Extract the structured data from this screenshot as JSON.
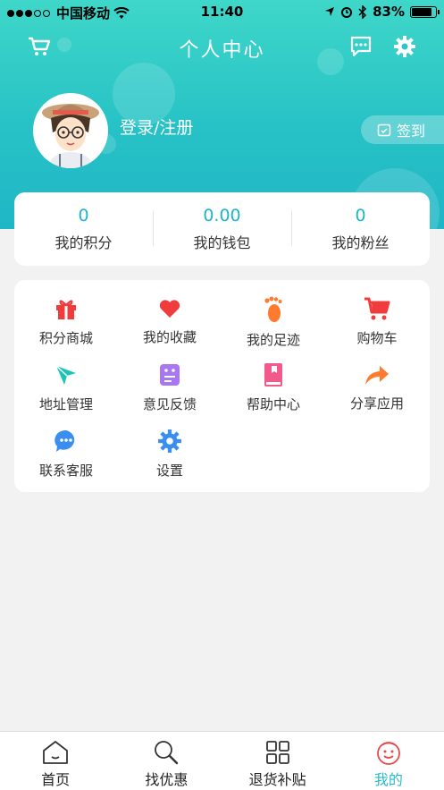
{
  "status_bar": {
    "carrier": "中国移动",
    "time": "11:40",
    "battery": "83%",
    "battery_level": 0.83
  },
  "header": {
    "title": "个人中心",
    "login_label": "登录/注册",
    "signin_label": "签到",
    "cart_icon": "cart-icon",
    "message_icon": "message-icon",
    "settings_icon": "gear-icon"
  },
  "stats": [
    {
      "value": "0",
      "label": "我的积分"
    },
    {
      "value": "0.00",
      "label": "我的钱包"
    },
    {
      "value": "0",
      "label": "我的粉丝"
    }
  ],
  "menu": [
    {
      "label": "积分商城",
      "icon": "gift-icon"
    },
    {
      "label": "我的收藏",
      "icon": "heart-icon"
    },
    {
      "label": "我的足迹",
      "icon": "footprint-icon"
    },
    {
      "label": "购物车",
      "icon": "cart-icon"
    },
    {
      "label": "地址管理",
      "icon": "location-icon"
    },
    {
      "label": "意见反馈",
      "icon": "feedback-icon"
    },
    {
      "label": "帮助中心",
      "icon": "help-book-icon"
    },
    {
      "label": "分享应用",
      "icon": "share-icon"
    },
    {
      "label": "联系客服",
      "icon": "chat-icon"
    },
    {
      "label": "设置",
      "icon": "gear-icon"
    }
  ],
  "tabs": [
    {
      "label": "首页",
      "icon": "home-icon"
    },
    {
      "label": "找优惠",
      "icon": "search-icon"
    },
    {
      "label": "退货补贴",
      "icon": "grid-icon"
    },
    {
      "label": "我的",
      "icon": "smile-icon",
      "active": true
    }
  ],
  "colors": {
    "accent": "#1cb6c8",
    "header_top": "#3fd7c9",
    "header_bottom": "#1fb6c6",
    "active_tab": "#2cb9c9"
  }
}
